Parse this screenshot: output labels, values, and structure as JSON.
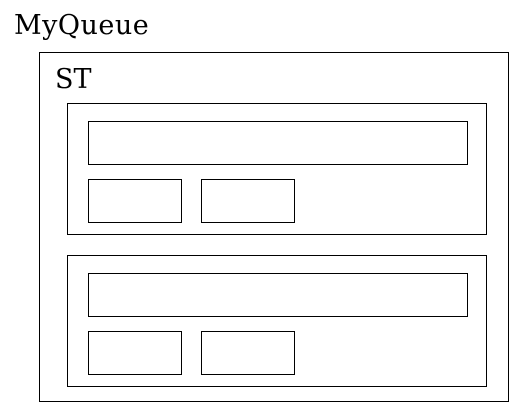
{
  "title": "MyQueue",
  "outer": {
    "label": "ST"
  },
  "colors": {
    "stroke": "#000000",
    "background": "#ffffff"
  }
}
